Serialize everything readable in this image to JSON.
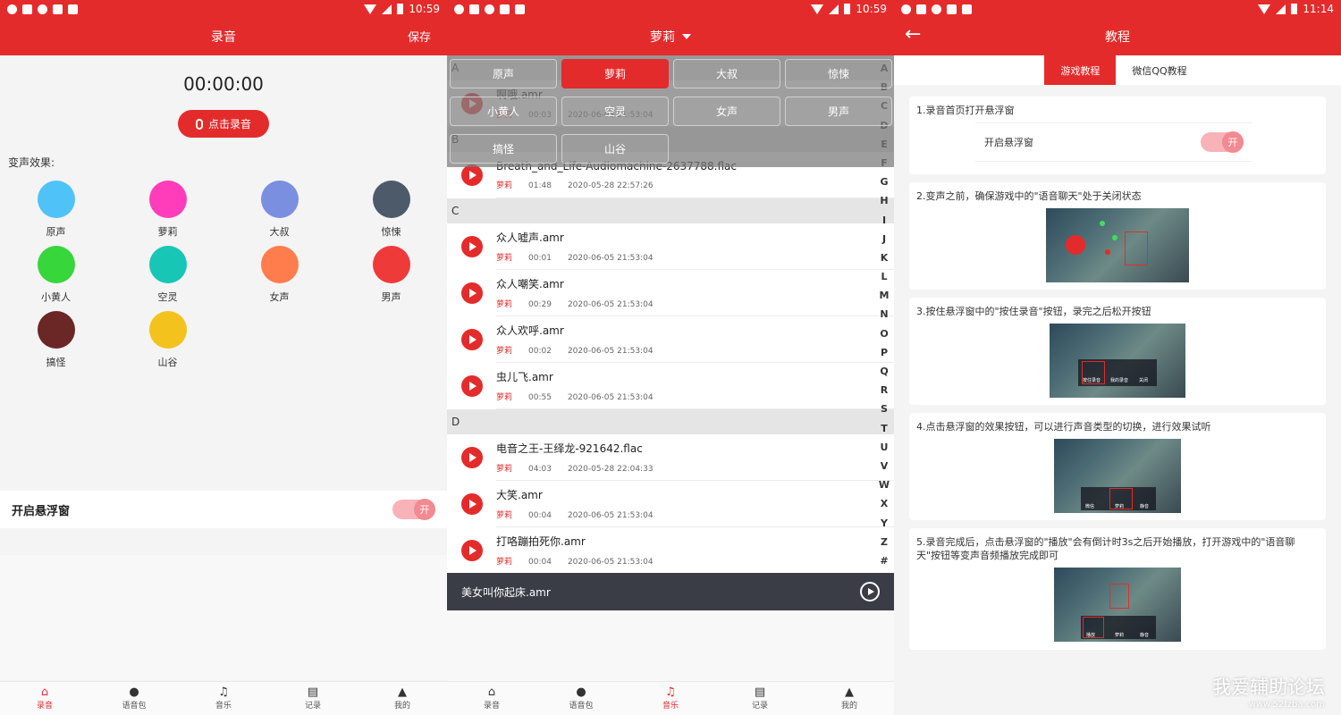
{
  "status": {
    "time1": "10:59",
    "time2": "10:59",
    "time3": "11:14"
  },
  "screen1": {
    "title": "录音",
    "save": "保存",
    "timer": "00:00:00",
    "record_btn": "点击录音",
    "effects_label": "变声效果:",
    "effects": [
      {
        "label": "原声",
        "color": "#4fc3f7"
      },
      {
        "label": "萝莉",
        "color": "#ff3dbb"
      },
      {
        "label": "大叔",
        "color": "#7b8fe0"
      },
      {
        "label": "惊悚",
        "color": "#4c5a6a"
      },
      {
        "label": "小黄人",
        "color": "#37d63a"
      },
      {
        "label": "空灵",
        "color": "#18c6b5"
      },
      {
        "label": "女声",
        "color": "#ff7c4d"
      },
      {
        "label": "男声",
        "color": "#ef3a3a"
      },
      {
        "label": "搞怪",
        "color": "#6b2626"
      },
      {
        "label": "山谷",
        "color": "#f4c21c"
      }
    ],
    "float_label": "开启悬浮窗",
    "toggle": "开"
  },
  "nav": [
    {
      "label": "录音",
      "icon": "⌂"
    },
    {
      "label": "语音包",
      "icon": "●"
    },
    {
      "label": "音乐",
      "icon": "♫"
    },
    {
      "label": "记录",
      "icon": "▤"
    },
    {
      "label": "我的",
      "icon": "▲"
    }
  ],
  "screen2": {
    "title": "萝莉",
    "chips": [
      "原声",
      "萝莉",
      "大叔",
      "惊悚",
      "小黄人",
      "空灵",
      "女声",
      "男声",
      "搞怪",
      "山谷"
    ],
    "sections": [
      {
        "letter": "A",
        "rows": [
          {
            "name": "啊哦.amr",
            "effect": "萝莉",
            "dur": "00:03",
            "date": "2020-06-05 21:53:04"
          }
        ]
      },
      {
        "letter": "B",
        "rows": [
          {
            "name": "Breath_and_Life-Audiomachine-2637788.flac",
            "effect": "萝莉",
            "dur": "01:48",
            "date": "2020-05-28 22:57:26"
          }
        ]
      },
      {
        "letter": "C",
        "rows": [
          {
            "name": "众人嘘声.amr",
            "effect": "萝莉",
            "dur": "00:01",
            "date": "2020-06-05 21:53:04"
          },
          {
            "name": "众人嘲笑.amr",
            "effect": "萝莉",
            "dur": "00:29",
            "date": "2020-06-05 21:53:04"
          },
          {
            "name": "众人欢呼.amr",
            "effect": "萝莉",
            "dur": "00:02",
            "date": "2020-06-05 21:53:04"
          },
          {
            "name": "虫儿飞.amr",
            "effect": "萝莉",
            "dur": "00:55",
            "date": "2020-06-05 21:53:04"
          }
        ]
      },
      {
        "letter": "D",
        "rows": [
          {
            "name": "电音之王-王绎龙-921642.flac",
            "effect": "萝莉",
            "dur": "04:03",
            "date": "2020-05-28 22:04:33"
          },
          {
            "name": "大笑.amr",
            "effect": "萝莉",
            "dur": "00:04",
            "date": "2020-06-05 21:53:04"
          },
          {
            "name": "打咯蹦拍死你.amr",
            "effect": "萝莉",
            "dur": "00:04",
            "date": "2020-06-05 21:53:04"
          }
        ]
      }
    ],
    "index": [
      "A",
      "B",
      "C",
      "D",
      "E",
      "F",
      "G",
      "H",
      "I",
      "J",
      "K",
      "L",
      "M",
      "N",
      "O",
      "P",
      "Q",
      "R",
      "S",
      "T",
      "U",
      "V",
      "W",
      "X",
      "Y",
      "Z",
      "#"
    ],
    "player": "美女叫你起床.amr"
  },
  "screen3": {
    "title": "教程",
    "tabs": [
      "游戏教程",
      "微信QQ教程"
    ],
    "cards": [
      "1.录音首页打开悬浮窗",
      "2.变声之前，确保游戏中的\"语音聊天\"处于关闭状态",
      "3.按住悬浮窗中的\"按住录音\"按钮，录完之后松开按钮",
      "4.点击悬浮窗的效果按钮，可以进行声音类型的切换，进行效果试听",
      "5.录音完成后，点击悬浮窗的\"播放\"会有倒计时3s之后开始播放，打开游戏中的\"语音聊天\"按钮等变声音频播放完成即可"
    ],
    "card1_toggle_label": "开启悬浮窗",
    "card1_toggle": "开",
    "shot3_labels": [
      "按住录音",
      "我的录音",
      "关闭"
    ],
    "shot4_labels": [
      "微信",
      "萝莉",
      "静音"
    ],
    "shot5_labels": [
      "播放",
      "萝莉",
      "静音"
    ]
  },
  "watermark": {
    "line1": "我爱辅助论坛",
    "line2": "www.52fzba.com"
  }
}
